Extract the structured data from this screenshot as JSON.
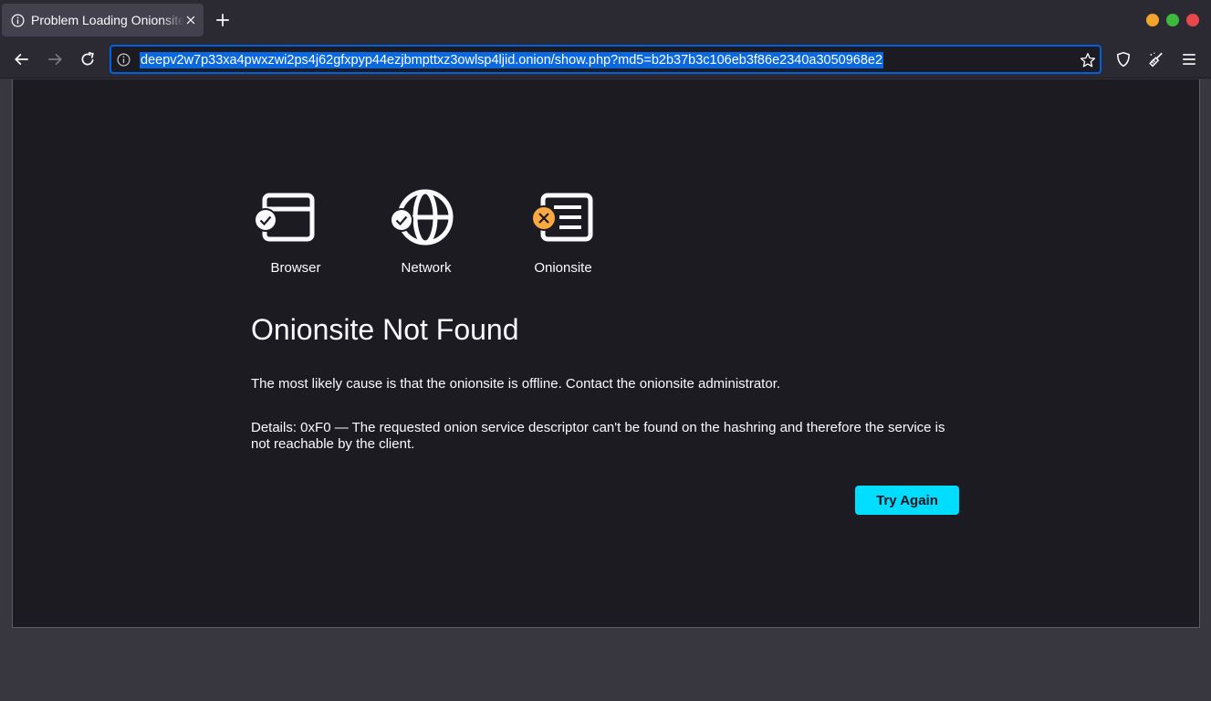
{
  "tab": {
    "title": "Problem Loading Onionsite",
    "icon": "info-icon"
  },
  "urlbar": {
    "url": "deepv2w7p33xa4pwxzwi2ps4j62gfxpyp44ezjbmpttxz3owlsp4ljid.onion/show.php?md5=b2b37b3c106eb3f86e2340a3050968e2"
  },
  "status": {
    "items": [
      {
        "label": "Browser",
        "state": "ok"
      },
      {
        "label": "Network",
        "state": "ok"
      },
      {
        "label": "Onionsite",
        "state": "error"
      }
    ]
  },
  "error": {
    "title": "Onionsite Not Found",
    "description": "The most likely cause is that the onionsite is offline. Contact the onionsite administrator.",
    "details": "Details: 0xF0 — The requested onion service descriptor can't be found on the hashring and therefore the service is not reachable by the client.",
    "try_again_label": "Try Again"
  },
  "colors": {
    "accent": "#00ddff",
    "url_highlight": "#0a68e0",
    "ok_badge": "#fbfbfe",
    "error_badge": "#f9a940"
  }
}
